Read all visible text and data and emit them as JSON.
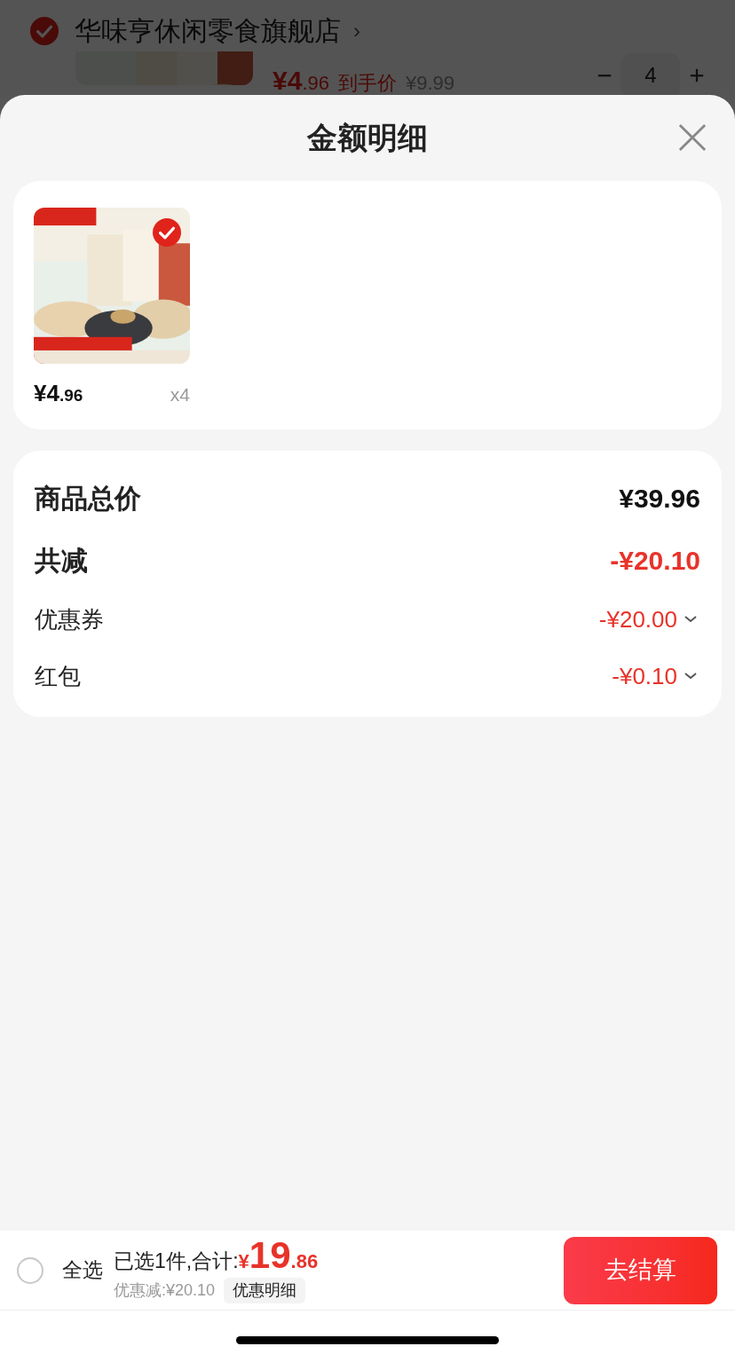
{
  "background": {
    "shop": {
      "name": "华味亨休闲零食旗舰店",
      "chevron": "›",
      "checked": true
    },
    "item": {
      "price_main": "¥4",
      "price_decimal": ".96",
      "price_label": "到手价",
      "original_price": "¥9.99",
      "quantity": "4"
    }
  },
  "sheet": {
    "title": "金额明细",
    "products": [
      {
        "kind": "picture",
        "selected": true,
        "price_main": "¥4",
        "price_decimal": ".96",
        "quantity": "x4"
      }
    ],
    "summary": [
      {
        "kind": "total",
        "label": "商品总价",
        "value": "¥39.96"
      },
      {
        "kind": "discount",
        "label": "共减",
        "value": "-¥20.10"
      },
      {
        "kind": "detail",
        "label": "优惠券",
        "value": "-¥20.00"
      },
      {
        "kind": "detail",
        "label": "红包",
        "value": "-¥0.10"
      }
    ]
  },
  "bottom_bar": {
    "select_all": {
      "label": "全选",
      "checked": false
    },
    "selected_text": "已选1件,合计:",
    "currency": "¥",
    "total_main": "19",
    "total_decimal": ".86",
    "savings": "优惠减:¥20.10",
    "details_button": "优惠明细",
    "checkout_button": "去结算"
  }
}
